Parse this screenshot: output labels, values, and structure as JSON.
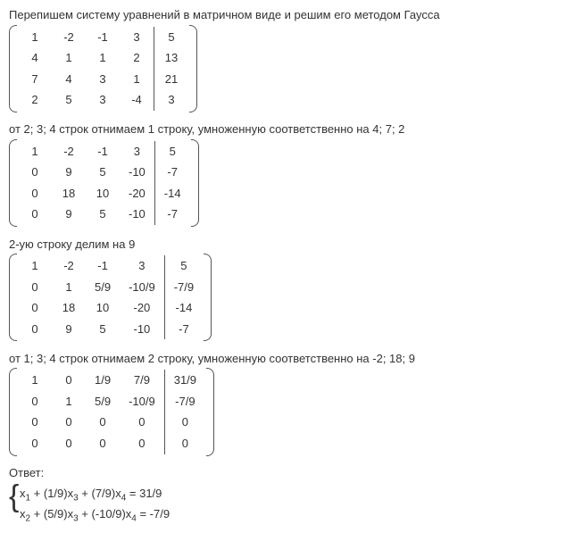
{
  "p1": "Перепишем систему уравнений в матричном виде и решим его методом Гаусса",
  "p2": "от 2; 3; 4 строк отнимаем 1 строку, умноженную соответственно на 4; 7; 2",
  "p3": "2-ую строку делим на 9",
  "p4": "от 1; 3; 4 строк отнимаем 2 строку, умноженную соответственно на -2; 18; 9",
  "answer_label": "Ответ:",
  "m1": [
    [
      "1",
      "-2",
      "-1",
      "3",
      "5"
    ],
    [
      "4",
      "1",
      "1",
      "2",
      "13"
    ],
    [
      "7",
      "4",
      "3",
      "1",
      "21"
    ],
    [
      "2",
      "5",
      "3",
      "-4",
      "3"
    ]
  ],
  "m2": [
    [
      "1",
      "-2",
      "-1",
      "3",
      "5"
    ],
    [
      "0",
      "9",
      "5",
      "-10",
      "-7"
    ],
    [
      "0",
      "18",
      "10",
      "-20",
      "-14"
    ],
    [
      "0",
      "9",
      "5",
      "-10",
      "-7"
    ]
  ],
  "m3": [
    [
      "1",
      "-2",
      "-1",
      "3",
      "5"
    ],
    [
      "0",
      "1",
      "5/9",
      "-10/9",
      "-7/9"
    ],
    [
      "0",
      "18",
      "10",
      "-20",
      "-14"
    ],
    [
      "0",
      "9",
      "5",
      "-10",
      "-7"
    ]
  ],
  "m4": [
    [
      "1",
      "0",
      "1/9",
      "7/9",
      "31/9"
    ],
    [
      "0",
      "1",
      "5/9",
      "-10/9",
      "-7/9"
    ],
    [
      "0",
      "0",
      "0",
      "0",
      "0"
    ],
    [
      "0",
      "0",
      "0",
      "0",
      "0"
    ]
  ],
  "eq1": {
    "a": "x",
    "a_sub": "1",
    "b": " + (1/9)x",
    "b_sub": "3",
    "c": " + (7/9)x",
    "c_sub": "4",
    "d": " = 31/9"
  },
  "eq2": {
    "a": "x",
    "a_sub": "2",
    "b": " + (5/9)x",
    "b_sub": "3",
    "c": " + (-10/9)x",
    "c_sub": "4",
    "d": " = -7/9"
  },
  "chart_data": {
    "type": "table",
    "title": "Решение системы линейных уравнений методом Гаусса",
    "matrices": [
      {
        "step": "initial",
        "rows": [
          [
            1,
            -2,
            -1,
            3,
            5
          ],
          [
            4,
            1,
            1,
            2,
            13
          ],
          [
            7,
            4,
            3,
            1,
            21
          ],
          [
            2,
            5,
            3,
            -4,
            3
          ]
        ],
        "aug_col_index": 4
      },
      {
        "step": "R2-=4R1; R3-=7R1; R4-=2R1",
        "rows": [
          [
            1,
            -2,
            -1,
            3,
            5
          ],
          [
            0,
            9,
            5,
            -10,
            -7
          ],
          [
            0,
            18,
            10,
            -20,
            -14
          ],
          [
            0,
            9,
            5,
            -10,
            -7
          ]
        ],
        "aug_col_index": 4
      },
      {
        "step": "R2/=9",
        "rows": [
          [
            1,
            -2,
            -1,
            3,
            5
          ],
          [
            0,
            1,
            "5/9",
            "-10/9",
            "-7/9"
          ],
          [
            0,
            18,
            10,
            -20,
            -14
          ],
          [
            0,
            9,
            5,
            -10,
            -7
          ]
        ],
        "aug_col_index": 4
      },
      {
        "step": "R1+=2R2; R3-=18R2; R4-=9R2",
        "rows": [
          [
            1,
            0,
            "1/9",
            "7/9",
            "31/9"
          ],
          [
            0,
            1,
            "5/9",
            "-10/9",
            "-7/9"
          ],
          [
            0,
            0,
            0,
            0,
            0
          ],
          [
            0,
            0,
            0,
            0,
            0
          ]
        ],
        "aug_col_index": 4
      }
    ],
    "solution": [
      "x1 + (1/9)x3 + (7/9)x4 = 31/9",
      "x2 + (5/9)x3 + (-10/9)x4 = -7/9"
    ]
  }
}
